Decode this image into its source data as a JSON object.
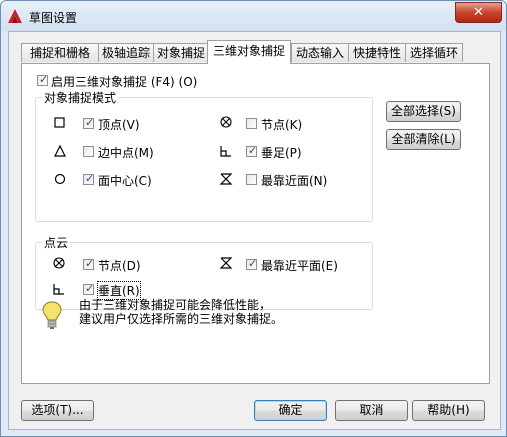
{
  "window": {
    "title": "草图设置",
    "close_symbol": "✕"
  },
  "tabs": [
    {
      "label": "捕捉和栅格"
    },
    {
      "label": "极轴追踪"
    },
    {
      "label": "对象捕捉"
    },
    {
      "label": "三维对象捕捉"
    },
    {
      "label": "动态输入"
    },
    {
      "label": "快捷特性"
    },
    {
      "label": "选择循环"
    }
  ],
  "active_tab": "三维对象捕捉",
  "enable": {
    "label": "启用三维对象捕捉 (F4) (O)",
    "checked": true
  },
  "object_snap_group": {
    "title": "对象捕捉模式",
    "items": [
      {
        "label": "顶点(V)",
        "checked": true,
        "icon": "vertex-square-icon"
      },
      {
        "label": "边中点(M)",
        "checked": false,
        "icon": "midpoint-triangle-icon"
      },
      {
        "label": "面中心(C)",
        "checked": true,
        "icon": "face-center-circle-icon"
      },
      {
        "label": "节点(K)",
        "checked": false,
        "icon": "knot-icon"
      },
      {
        "label": "垂足(P)",
        "checked": true,
        "icon": "perpendicular-icon"
      },
      {
        "label": "最靠近面(N)",
        "checked": false,
        "icon": "nearest-face-icon"
      }
    ]
  },
  "point_cloud_group": {
    "title": "点云",
    "items": [
      {
        "label": "节点(D)",
        "checked": true,
        "icon": "knot-icon"
      },
      {
        "label": "垂直(R)",
        "checked": true,
        "icon": "perpendicular-icon"
      },
      {
        "label": "最靠近平面(E)",
        "checked": true,
        "icon": "nearest-plane-icon"
      }
    ]
  },
  "side_buttons": {
    "select_all": "全部选择(S)",
    "clear_all": "全部清除(L)"
  },
  "note": {
    "line1": "由于三维对象捕捉可能会降低性能，",
    "line2": "建议用户仅选择所需的三维对象捕捉。"
  },
  "footer": {
    "options": "选项(T)...",
    "ok": "确定",
    "cancel": "取消",
    "help": "帮助(H)"
  },
  "colors": {
    "check": "#2c4e8c",
    "close_button": "#c6452f",
    "frame": "#dfe9f5"
  }
}
